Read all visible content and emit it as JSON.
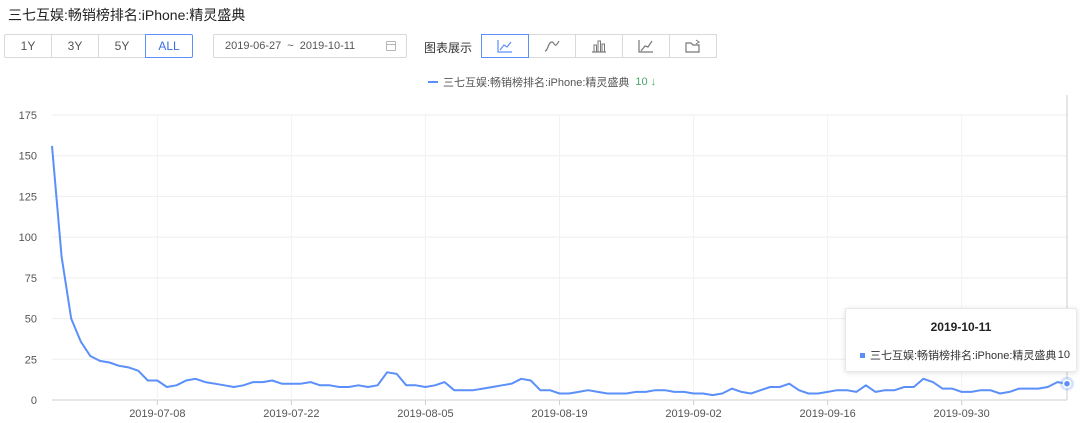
{
  "page_title": "三七互娱:畅销榜排名:iPhone:精灵盛典",
  "range_buttons": [
    {
      "label": "1Y",
      "active": false
    },
    {
      "label": "3Y",
      "active": false
    },
    {
      "label": "5Y",
      "active": false
    },
    {
      "label": "ALL",
      "active": true
    }
  ],
  "date_range": {
    "start": "2019-06-27",
    "separator": "~",
    "end": "2019-10-11"
  },
  "chart_type": {
    "label": "图表展示",
    "buttons": [
      {
        "icon": "line-chart-icon",
        "active": true
      },
      {
        "icon": "smooth-line-icon",
        "active": false
      },
      {
        "icon": "bar-chart-icon",
        "active": false
      },
      {
        "icon": "area-chart-icon",
        "active": false
      },
      {
        "icon": "folder-export-icon",
        "active": false
      }
    ]
  },
  "legend": {
    "name": "三七互娱:畅销榜排名:iPhone:精灵盛典",
    "value": "10",
    "arrow": "↓"
  },
  "tooltip": {
    "date": "2019-10-11",
    "series": "三七互娱:畅销榜排名:iPhone:精灵盛典",
    "value": "10"
  },
  "colors": {
    "series": "#5b8ff9",
    "trend_down": "#4aa66b",
    "active_border": "#5b8ff9"
  },
  "chart_data": {
    "type": "line",
    "x_start": "2019-06-27",
    "x_end": "2019-10-11",
    "x_ticks": [
      "2019-07-08",
      "2019-07-22",
      "2019-08-05",
      "2019-08-19",
      "2019-09-02",
      "2019-09-16",
      "2019-09-30"
    ],
    "y_ticks": [
      0,
      25,
      50,
      75,
      100,
      125,
      150,
      175
    ],
    "ylim": [
      0,
      175
    ],
    "grid": true,
    "legend_position": "top-center",
    "series": [
      {
        "name": "三七互娱:畅销榜排名:iPhone:精灵盛典",
        "points": [
          [
            "2019-06-27",
            156
          ],
          [
            "2019-06-28",
            88
          ],
          [
            "2019-06-29",
            50
          ],
          [
            "2019-06-30",
            36
          ],
          [
            "2019-07-01",
            27
          ],
          [
            "2019-07-02",
            24
          ],
          [
            "2019-07-03",
            23
          ],
          [
            "2019-07-04",
            21
          ],
          [
            "2019-07-05",
            20
          ],
          [
            "2019-07-06",
            18
          ],
          [
            "2019-07-07",
            12
          ],
          [
            "2019-07-08",
            12
          ],
          [
            "2019-07-09",
            8
          ],
          [
            "2019-07-10",
            9
          ],
          [
            "2019-07-11",
            12
          ],
          [
            "2019-07-12",
            13
          ],
          [
            "2019-07-13",
            11
          ],
          [
            "2019-07-14",
            10
          ],
          [
            "2019-07-15",
            9
          ],
          [
            "2019-07-16",
            8
          ],
          [
            "2019-07-17",
            9
          ],
          [
            "2019-07-18",
            11
          ],
          [
            "2019-07-19",
            11
          ],
          [
            "2019-07-20",
            12
          ],
          [
            "2019-07-21",
            10
          ],
          [
            "2019-07-22",
            10
          ],
          [
            "2019-07-23",
            10
          ],
          [
            "2019-07-24",
            11
          ],
          [
            "2019-07-25",
            9
          ],
          [
            "2019-07-26",
            9
          ],
          [
            "2019-07-27",
            8
          ],
          [
            "2019-07-28",
            8
          ],
          [
            "2019-07-29",
            9
          ],
          [
            "2019-07-30",
            8
          ],
          [
            "2019-07-31",
            9
          ],
          [
            "2019-08-01",
            17
          ],
          [
            "2019-08-02",
            16
          ],
          [
            "2019-08-03",
            9
          ],
          [
            "2019-08-04",
            9
          ],
          [
            "2019-08-05",
            8
          ],
          [
            "2019-08-06",
            9
          ],
          [
            "2019-08-07",
            11
          ],
          [
            "2019-08-08",
            6
          ],
          [
            "2019-08-09",
            6
          ],
          [
            "2019-08-10",
            6
          ],
          [
            "2019-08-11",
            7
          ],
          [
            "2019-08-12",
            8
          ],
          [
            "2019-08-13",
            9
          ],
          [
            "2019-08-14",
            10
          ],
          [
            "2019-08-15",
            13
          ],
          [
            "2019-08-16",
            12
          ],
          [
            "2019-08-17",
            6
          ],
          [
            "2019-08-18",
            6
          ],
          [
            "2019-08-19",
            4
          ],
          [
            "2019-08-20",
            4
          ],
          [
            "2019-08-21",
            5
          ],
          [
            "2019-08-22",
            6
          ],
          [
            "2019-08-23",
            5
          ],
          [
            "2019-08-24",
            4
          ],
          [
            "2019-08-25",
            4
          ],
          [
            "2019-08-26",
            4
          ],
          [
            "2019-08-27",
            5
          ],
          [
            "2019-08-28",
            5
          ],
          [
            "2019-08-29",
            6
          ],
          [
            "2019-08-30",
            6
          ],
          [
            "2019-08-31",
            5
          ],
          [
            "2019-09-01",
            5
          ],
          [
            "2019-09-02",
            4
          ],
          [
            "2019-09-03",
            4
          ],
          [
            "2019-09-04",
            3
          ],
          [
            "2019-09-05",
            4
          ],
          [
            "2019-09-06",
            7
          ],
          [
            "2019-09-07",
            5
          ],
          [
            "2019-09-08",
            4
          ],
          [
            "2019-09-09",
            6
          ],
          [
            "2019-09-10",
            8
          ],
          [
            "2019-09-11",
            8
          ],
          [
            "2019-09-12",
            10
          ],
          [
            "2019-09-13",
            6
          ],
          [
            "2019-09-14",
            4
          ],
          [
            "2019-09-15",
            4
          ],
          [
            "2019-09-16",
            5
          ],
          [
            "2019-09-17",
            6
          ],
          [
            "2019-09-18",
            6
          ],
          [
            "2019-09-19",
            5
          ],
          [
            "2019-09-20",
            9
          ],
          [
            "2019-09-21",
            5
          ],
          [
            "2019-09-22",
            6
          ],
          [
            "2019-09-23",
            6
          ],
          [
            "2019-09-24",
            8
          ],
          [
            "2019-09-25",
            8
          ],
          [
            "2019-09-26",
            13
          ],
          [
            "2019-09-27",
            11
          ],
          [
            "2019-09-28",
            7
          ],
          [
            "2019-09-29",
            7
          ],
          [
            "2019-09-30",
            5
          ],
          [
            "2019-10-01",
            5
          ],
          [
            "2019-10-02",
            6
          ],
          [
            "2019-10-03",
            6
          ],
          [
            "2019-10-04",
            4
          ],
          [
            "2019-10-05",
            5
          ],
          [
            "2019-10-06",
            7
          ],
          [
            "2019-10-07",
            7
          ],
          [
            "2019-10-08",
            7
          ],
          [
            "2019-10-09",
            8
          ],
          [
            "2019-10-10",
            11
          ],
          [
            "2019-10-11",
            10
          ]
        ]
      }
    ]
  }
}
